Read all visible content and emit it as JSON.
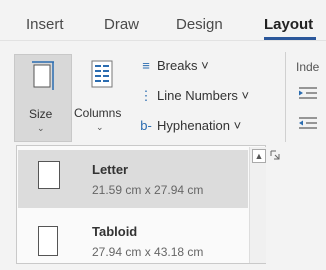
{
  "tabs": [
    {
      "label": "Insert"
    },
    {
      "label": "Draw"
    },
    {
      "label": "Design"
    },
    {
      "label": "Layout",
      "active": true
    }
  ],
  "ribbon": {
    "size_label": "Size",
    "columns_label": "Columns",
    "breaks_label": "Breaks ˅",
    "line_numbers_label": "Line Numbers ˅",
    "hyphenation_label": "Hyphenation ˅",
    "indent_partial_label": "Inde"
  },
  "size_menu": {
    "items": [
      {
        "name": "Letter",
        "dims": "21.59 cm x 27.94 cm",
        "selected": true
      },
      {
        "name": "Tabloid",
        "dims": "27.94 cm x 43.18 cm",
        "selected": false
      }
    ]
  },
  "colors": {
    "accent": "#2b579a",
    "menu_selected": "#dcdcdc"
  }
}
